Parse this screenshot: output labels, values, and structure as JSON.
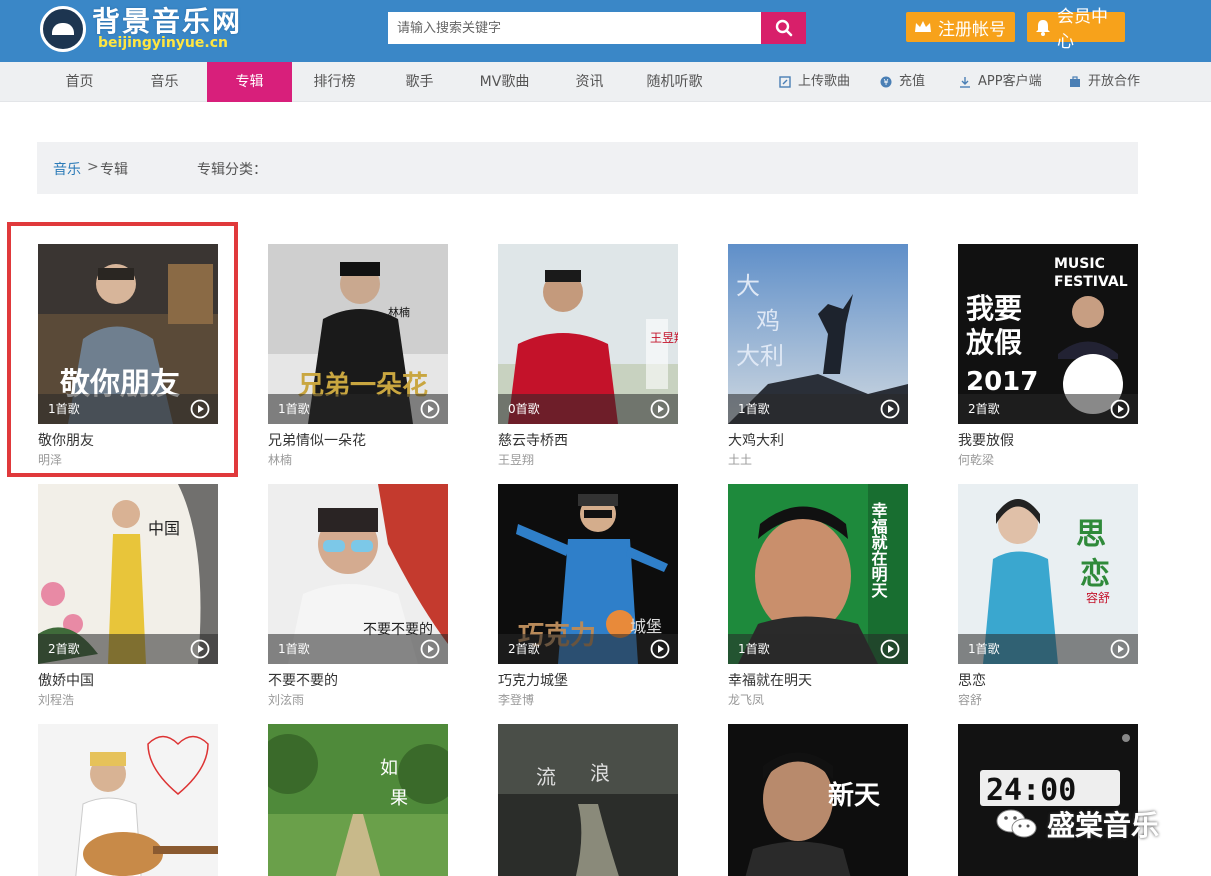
{
  "header": {
    "logo_title": "背景音乐网",
    "logo_sub": "beijingyinyue.cn",
    "search_placeholder": "请输入搜索关键字",
    "register_label": "注册帐号",
    "member_label": "会员中心"
  },
  "nav": {
    "items": [
      "首页",
      "音乐",
      "专辑",
      "排行榜",
      "歌手",
      "MV歌曲",
      "资讯",
      "随机听歌"
    ],
    "active_index": 2,
    "right": [
      "上传歌曲",
      "充值",
      "APP客户端",
      "开放合作"
    ]
  },
  "breadcrumb": {
    "root": "音乐",
    "sep": ">",
    "current": "专辑",
    "category_label": "专辑分类："
  },
  "albums": [
    {
      "title": "敬你朋友",
      "artist": "明泽",
      "count": "1首歌"
    },
    {
      "title": "兄弟情似一朵花",
      "artist": "林楠",
      "count": "1首歌"
    },
    {
      "title": "慈云寺桥西",
      "artist": "王昱翔",
      "count": "0首歌"
    },
    {
      "title": "大鸡大利",
      "artist": "土土",
      "count": "1首歌"
    },
    {
      "title": "我要放假",
      "artist": "何乾梁",
      "count": "2首歌"
    },
    {
      "title": "傲娇中国",
      "artist": "刘程浩",
      "count": "2首歌"
    },
    {
      "title": "不要不要的",
      "artist": "刘泫雨",
      "count": "1首歌"
    },
    {
      "title": "巧克力城堡",
      "artist": "李登博",
      "count": "2首歌"
    },
    {
      "title": "幸福就在明天",
      "artist": "龙飞凤",
      "count": "1首歌"
    },
    {
      "title": "思恋",
      "artist": "容舒",
      "count": "1首歌"
    }
  ],
  "watermark": "盛棠音乐"
}
